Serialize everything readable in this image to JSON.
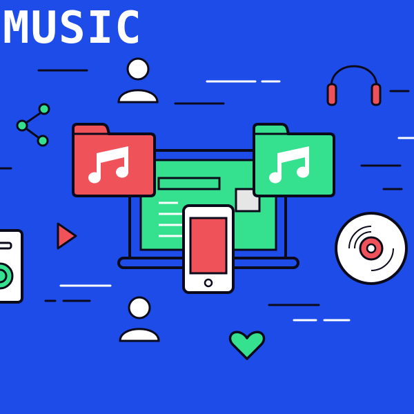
{
  "title": "MUSIC",
  "colors": {
    "background": "#1e4ce8",
    "outline": "#0a0a1a",
    "white": "#ffffff",
    "red": "#f0525a",
    "green": "#35e08e",
    "accent_line": "#ffffff"
  },
  "illustration": {
    "elements": [
      "music-note-folder-red",
      "music-note-folder-green",
      "laptop",
      "smartphone",
      "headphones-icon",
      "vinyl-disc-icon",
      "share-icon",
      "play-icon",
      "heart-icon",
      "user-icon",
      "speaker-icon"
    ]
  }
}
